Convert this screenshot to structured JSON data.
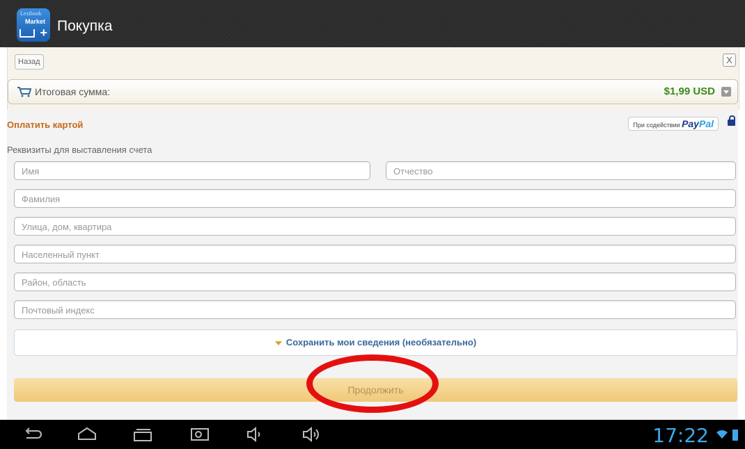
{
  "app": {
    "title": "Покупка",
    "icon_text_top": "Lexibook",
    "icon_text_mid": "Market",
    "icon_plus": "+"
  },
  "header": {
    "back_label": "Назад",
    "close_label": "X",
    "total_label": "Итоговая сумма:",
    "total_value": "$1,99 USD"
  },
  "form": {
    "pay_title": "Оплатить картой",
    "paypal_prefix": "При содействии",
    "paypal_brand_1": "Pay",
    "paypal_brand_2": "Pal",
    "section_label": "Реквизиты для выставления счета",
    "fields": {
      "first_name": "Имя",
      "middle_name": "Отчество",
      "last_name": "Фамилия",
      "street": "Улица, дом, квартира",
      "city": "Населенный пункт",
      "region": "Район, область",
      "postal": "Почтовый индекс"
    },
    "save_label": "Сохранить мои сведения (необязательно)",
    "continue_label": "Продолжить"
  },
  "status": {
    "time": "17:22"
  },
  "colors": {
    "accent_orange": "#c66a1a",
    "price_green": "#3a8a1d",
    "clock_blue": "#3ca8e8",
    "highlight_red": "#e41010"
  },
  "nav_icons": [
    "back-icon",
    "home-icon",
    "recent-apps-icon",
    "screenshot-icon",
    "volume-down-icon",
    "volume-up-icon"
  ]
}
